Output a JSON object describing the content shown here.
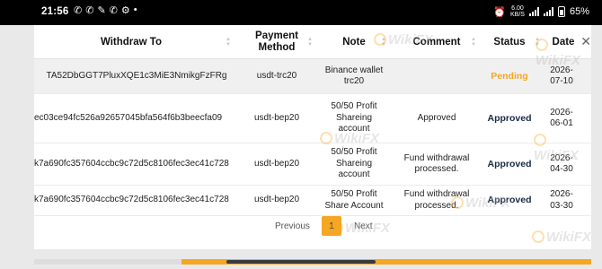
{
  "statusbar": {
    "time": "21:56",
    "left_icons": [
      "whatsapp-icon",
      "whatsapp-icon",
      "feather-icon",
      "whatsapp-icon",
      "settings-icon",
      "dot-icon"
    ],
    "speed_top": "6.00",
    "speed_bottom": "KB/S",
    "battery_percent": "65%"
  },
  "table": {
    "headers": {
      "withdraw_to": "Withdraw To",
      "payment_method": "Payment Method",
      "note": "Note",
      "comment": "Comment",
      "status": "Status",
      "date": "Date"
    },
    "rows": [
      {
        "withdraw_to": "TA52DbGGT7PluxXQE1c3MiE3NmikgFzFRg",
        "payment_method": "usdt-trc20",
        "note": "Binance wallet trc20",
        "comment": "",
        "status": "Pending",
        "date": "2026-07-10"
      },
      {
        "withdraw_to": "ec03ce94fc526a92657045bfa564f6b3beecfa09",
        "payment_method": "usdt-bep20",
        "note": "50/50 Profit Shareing account",
        "comment": "Approved",
        "status": "Approved",
        "date": "2026-06-01"
      },
      {
        "withdraw_to": "k7a690fc357604ccbc9c72d5c8106fec3ec41c728",
        "payment_method": "usdt-bep20",
        "note": "50/50 Profit Shareing account",
        "comment": "Fund withdrawal processed.",
        "status": "Approved",
        "date": "2026-04-30"
      },
      {
        "withdraw_to": "k7a690fc357604ccbc9c72d5c8106fec3ec41c728",
        "payment_method": "usdt-bep20",
        "note": "50/50 Profit Share Account",
        "comment": "Fund withdrawal processed.",
        "status": "Approved",
        "date": "2026-03-30"
      }
    ]
  },
  "pagination": {
    "previous": "Previous",
    "current_page": "1",
    "next": "Next"
  },
  "watermark": "WikiFX",
  "colors": {
    "accent": "#f5a623",
    "approved": "#1b2a44",
    "pending": "#f5a623"
  }
}
